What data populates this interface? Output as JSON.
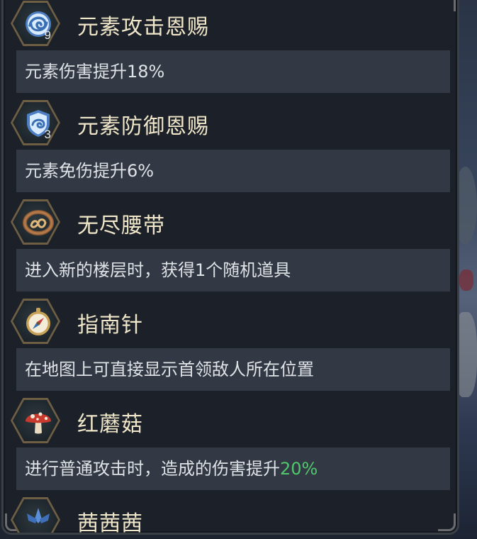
{
  "items": [
    {
      "title": "元素攻击恩赐",
      "count": "9",
      "icon": "swirl-element-icon",
      "desc": "元素伤害提升18%",
      "desc_highlight": ""
    },
    {
      "title": "元素防御恩赐",
      "count": "3",
      "icon": "element-shield-icon",
      "desc": "元素免伤提升6%",
      "desc_highlight": ""
    },
    {
      "title": "无尽腰带",
      "count": "",
      "icon": "belt-icon",
      "desc": "进入新的楼层时，获得1个随机道具",
      "desc_highlight": ""
    },
    {
      "title": "指南针",
      "count": "",
      "icon": "compass-icon",
      "desc": "在地图上可直接显示首领敌人所在位置",
      "desc_highlight": ""
    },
    {
      "title": "红蘑菇",
      "count": "",
      "icon": "red-mushroom-icon",
      "desc": "进行普通攻击时，造成的伤害提升",
      "desc_highlight": "20%"
    },
    {
      "title": "茜茜茜",
      "count": "",
      "icon": "blue-crystal-icon",
      "desc": "",
      "desc_highlight": ""
    }
  ],
  "colors": {
    "title": "#f0e6c9",
    "desc_text": "#dfe2e6",
    "desc_bg": "#333944",
    "highlight": "#4fc86b",
    "hex_border": "#6e5f44"
  }
}
